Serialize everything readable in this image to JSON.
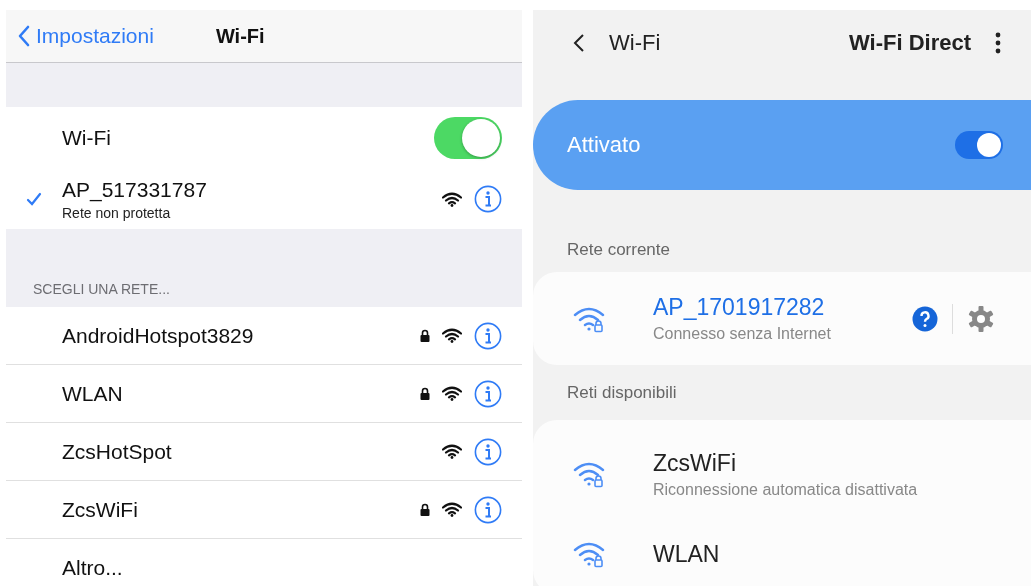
{
  "ios": {
    "back_label": "Impostazioni",
    "title": "Wi-Fi",
    "wifi": {
      "label": "Wi-Fi",
      "on": true
    },
    "connected": {
      "name": "AP_517331787",
      "subtitle": "Rete non protetta",
      "selected": true
    },
    "section_label": "SCEGLI UNA RETE...",
    "networks": [
      {
        "name": "AndroidHotspot3829",
        "locked": true
      },
      {
        "name": "WLAN",
        "locked": true
      },
      {
        "name": "ZcsHotSpot",
        "locked": false
      },
      {
        "name": "ZcsWiFi",
        "locked": true
      }
    ],
    "other_label": "Altro..."
  },
  "android": {
    "title": "Wi-Fi",
    "action_label": "Wi-Fi Direct",
    "master": {
      "label": "Attivato",
      "on": true
    },
    "current_label": "Rete corrente",
    "current": {
      "name": "AP_1701917282",
      "status": "Connesso senza Internet"
    },
    "available_label": "Reti disponibili",
    "networks": [
      {
        "name": "ZcsWiFi",
        "status": "Riconnessione automatica disattivata"
      },
      {
        "name": "WLAN"
      }
    ]
  }
}
